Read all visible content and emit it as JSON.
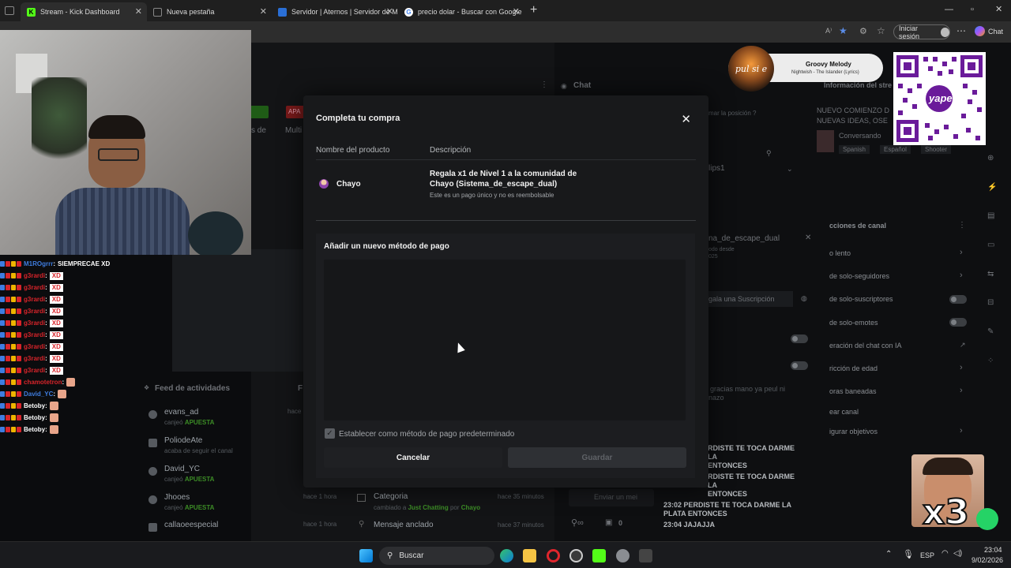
{
  "browser": {
    "tabs": [
      {
        "title": "Stream - Kick Dashboard",
        "active": true
      },
      {
        "title": "Nueva pestaña",
        "active": false
      },
      {
        "title": "Servidor | Aternos | Servidor de M",
        "active": false
      },
      {
        "title": "precio dolar - Buscar con Google",
        "active": false
      }
    ],
    "sign_in_label": "Iniciar sesión",
    "chat_label": "Chat",
    "add_tab": "+"
  },
  "overlay_chat": [
    {
      "user": "M1ROgrrr",
      "text": "SIEMPRECAE XD",
      "color": "#3f7de0",
      "kind": "text"
    },
    {
      "user": "g3rardi",
      "text": "XD",
      "color": "#d8242a",
      "kind": "xd"
    },
    {
      "user": "g3rardi",
      "text": "XD",
      "color": "#d8242a",
      "kind": "xd"
    },
    {
      "user": "g3rardi",
      "text": "XD",
      "color": "#d8242a",
      "kind": "xd"
    },
    {
      "user": "g3rardi",
      "text": "XD",
      "color": "#d8242a",
      "kind": "xd"
    },
    {
      "user": "g3rardi",
      "text": "XD",
      "color": "#d8242a",
      "kind": "xd"
    },
    {
      "user": "g3rardi",
      "text": "XD",
      "color": "#d8242a",
      "kind": "xd"
    },
    {
      "user": "g3rardi",
      "text": "XD",
      "color": "#d8242a",
      "kind": "xd"
    },
    {
      "user": "g3rardi",
      "text": "XD",
      "color": "#d8242a",
      "kind": "xd"
    },
    {
      "user": "g3rardi",
      "text": "XD",
      "color": "#d8242a",
      "kind": "xd"
    },
    {
      "user": "chamotetron",
      "text": "",
      "color": "#d8242a",
      "kind": "emote"
    },
    {
      "user": "David_YC",
      "text": "",
      "color": "#3f7de0",
      "kind": "emote"
    },
    {
      "user": "Betoby",
      "text": "",
      "color": "#ffffff",
      "kind": "emote"
    },
    {
      "user": "Betoby",
      "text": "",
      "color": "#ffffff",
      "kind": "emote"
    },
    {
      "user": "Betoby",
      "text": "",
      "color": "#ffffff",
      "kind": "emote"
    }
  ],
  "dashboard": {
    "chat_header": "Chat",
    "stream_info_header": "Información del stre",
    "stream_title_line1": "NUEVO COMIENZO D",
    "stream_title_line2": "NUEVAS IDEAS, OSE",
    "category": "Conversando",
    "tags": [
      "Spanish",
      "Español",
      "Shooter"
    ],
    "activity_feed_title": "Feed de actividades",
    "activity": [
      {
        "user": "evans_ad",
        "action": "canjeó",
        "item": "APUESTA",
        "time": "hace"
      },
      {
        "user": "PoliodeAte",
        "action": "acaba de seguir el canal",
        "item": "",
        "time": ""
      },
      {
        "user": "David_YC",
        "action": "canjeó",
        "item": "APUESTA",
        "time": ""
      },
      {
        "user": "Jhooes",
        "action": "canjeó",
        "item": "APUESTA",
        "time": "hace 1 hora"
      },
      {
        "user": "callaoeespecial",
        "action": "",
        "item": "",
        "time": "hace 1 hora"
      }
    ],
    "category_event": {
      "title": "Categoria",
      "text": "cambiado a",
      "cat": "Just Chatting",
      "by": "por",
      "user": "Chayo",
      "time": "hace 35 minutos"
    },
    "pinned_event": {
      "title": "Mensaje anclado",
      "time": "hace 37 minutos"
    },
    "chat_input_placeholder": "Enviar un mei",
    "chat_counter": "0",
    "chat_messages": [
      "RDISTE TE TOCA DARME LA",
      "ENTONCES",
      "RDISTE TE TOCA DARME LA",
      "ENTONCES",
      "23:02 PERDISTE TE TOCA DARME LA",
      "PLATA ENTONCES",
      "23:04 JAJAJJA"
    ],
    "mod_sections_title": "cciones de canal",
    "mod_items": [
      "o lento",
      "de solo-seguidores",
      "de solo-suscriptores",
      "de solo-emotes",
      "eración del chat con IA",
      "ricción de edad",
      "oras baneadas",
      "ear canal",
      "igurar objetivos"
    ],
    "gift_chip": "gala una Suscripción",
    "escape_title": "na_de_escape_dual",
    "escape_sub1": "odo desde",
    "escape_sub2": "025",
    "position_hint": "mar la posición ?",
    "clips_label": "lips1",
    "chat_reply": "gracias mano ya peul ni",
    "chat_reply2": "nazo",
    "tab_labels": [
      "s de",
      "Multi"
    ],
    "dimmed_badge": "APA",
    "dimmed_letter": "F"
  },
  "modal": {
    "title": "Completa tu compra",
    "col_product": "Nombre del producto",
    "col_description": "Descripción",
    "product_name": "Chayo",
    "description_line1": "Regala x1 de Nivel 1 a la comunidad de",
    "description_line2": "Chayo (Sistema_de_escape_dual)",
    "description_note": "Este es un pago único y no es reembolsable",
    "payment_section": "Añadir un nuevo método de pago",
    "default_checkbox_label": "Establecer como método de pago predeterminado",
    "default_checked": true,
    "cancel_label": "Cancelar",
    "save_label": "Guardar"
  },
  "now_playing": {
    "title": "Groovy Melody",
    "subtitle": "Nightwish - The Islander (Lyrics)",
    "logo_text": "pul si e"
  },
  "qr_brand": "yape",
  "facecam_caption": "x3",
  "taskbar": {
    "search_placeholder": "Buscar",
    "language": "ESP",
    "time": "23:04",
    "date": "9/02/2026"
  },
  "colors": {
    "kick_green": "#53fc18",
    "accent_green": "#3c8c26",
    "qr_purple": "#6a1b9a"
  }
}
